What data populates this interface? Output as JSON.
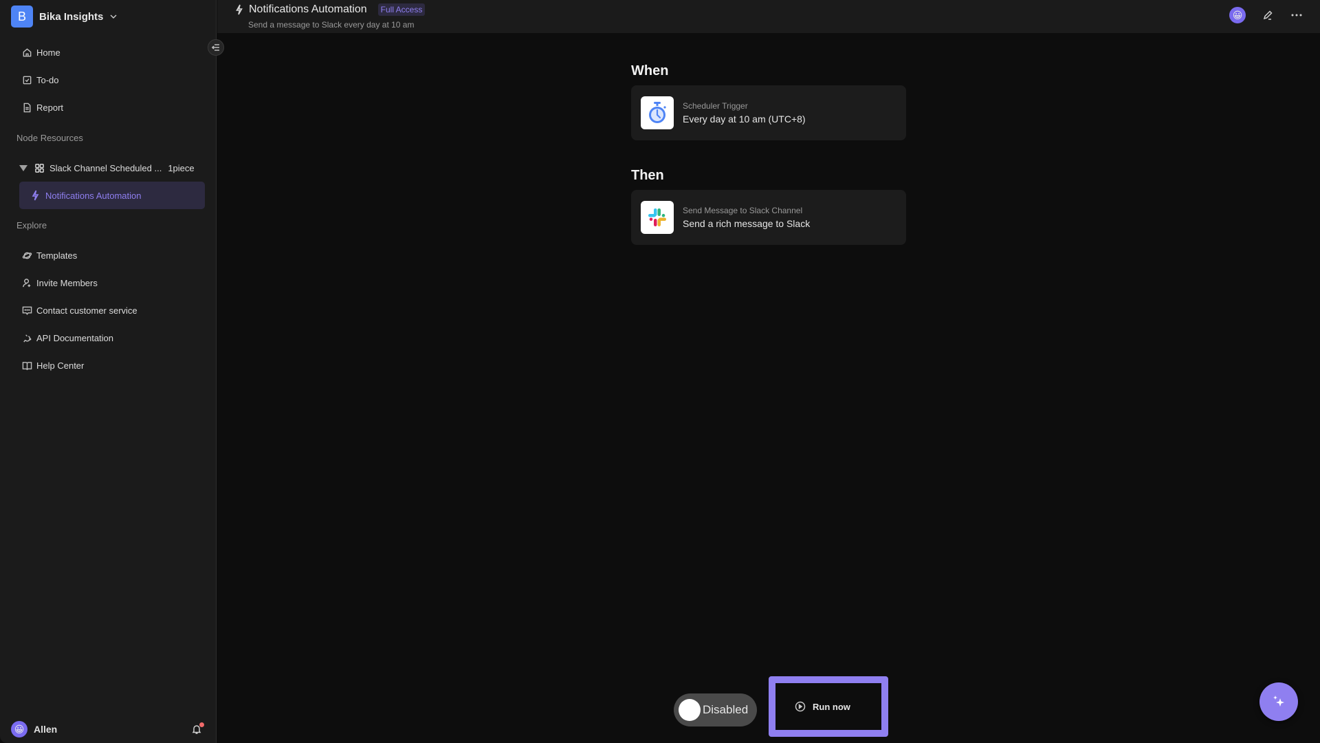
{
  "workspace": {
    "logo_letter": "B",
    "name": "Bika Insights"
  },
  "sidebar": {
    "nav": [
      {
        "label": "Home",
        "icon": "home-icon"
      },
      {
        "label": "To-do",
        "icon": "checkbox-icon"
      },
      {
        "label": "Report",
        "icon": "document-icon"
      }
    ],
    "node_resources_label": "Node Resources",
    "folder": {
      "label": "Slack Channel Scheduled ...",
      "count": "1piece"
    },
    "active_item": {
      "label": "Notifications Automation"
    },
    "explore_label": "Explore",
    "explore": [
      {
        "label": "Templates",
        "icon": "planet-icon"
      },
      {
        "label": "Invite Members",
        "icon": "user-plus-icon"
      },
      {
        "label": "Contact customer service",
        "icon": "chat-icon"
      },
      {
        "label": "API Documentation",
        "icon": "api-icon"
      },
      {
        "label": "Help Center",
        "icon": "book-icon"
      }
    ],
    "user": {
      "name": "Allen",
      "avatar": "😀"
    },
    "notifications_unread": true
  },
  "topbar": {
    "title": "Notifications Automation",
    "badge": "Full Access",
    "subtitle": "Send a message to Slack every day at 10 am",
    "avatar": "😀"
  },
  "automation": {
    "when_label": "When",
    "trigger": {
      "type": "Scheduler Trigger",
      "description": "Every day at 10 am (UTC+8)",
      "icon": "stopwatch-icon"
    },
    "then_label": "Then",
    "action": {
      "type": "Send Message to Slack Channel",
      "description": "Send a rich message to Slack",
      "icon": "slack-icon"
    }
  },
  "controls": {
    "toggle_label": "Disabled",
    "enabled": false,
    "run_label": "Run now"
  },
  "colors": {
    "accent": "#8f7ff0",
    "workspace_logo": "#4e84f5",
    "notification_dot": "#f06a6a"
  }
}
